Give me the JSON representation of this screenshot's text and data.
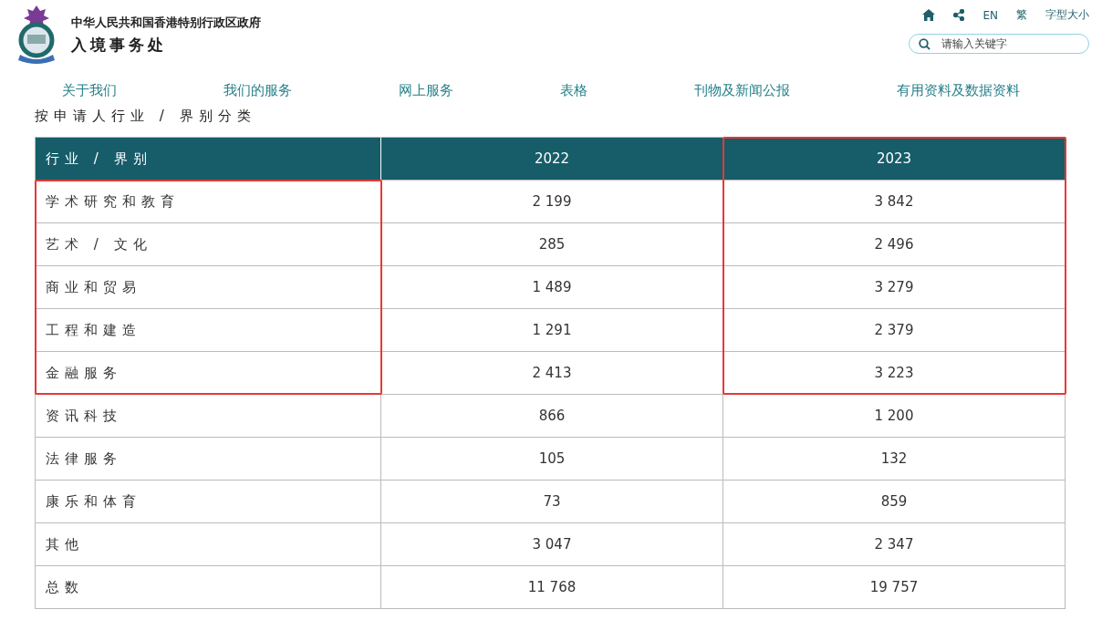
{
  "header": {
    "government": "中华人民共和国香港特别行政区政府",
    "department": "入境事务处"
  },
  "utility_links": [
    "EN",
    "繁",
    "字型大小"
  ],
  "search": {
    "placeholder": "请输入关键字"
  },
  "nav": [
    "关于我们",
    "我们的服务",
    "网上服务",
    "表格",
    "刊物及新闻公报",
    "有用资料及数据资料"
  ],
  "page_title": "按申请人行业 / 界别分类",
  "table": {
    "columns": [
      {
        "label": "行业 / 界别",
        "highlighted": false
      },
      {
        "label": "2022",
        "highlighted": false
      },
      {
        "label": "2023",
        "highlighted": true
      }
    ],
    "rows": [
      {
        "cells": [
          {
            "text": "学术研究和教育",
            "highlighted": true
          },
          {
            "text": "2 199",
            "highlighted": false
          },
          {
            "text": "3 842",
            "highlighted": true
          }
        ]
      },
      {
        "cells": [
          {
            "text": "艺术 / 文化",
            "highlighted": true
          },
          {
            "text": "285",
            "highlighted": false
          },
          {
            "text": "2 496",
            "highlighted": true
          }
        ]
      },
      {
        "cells": [
          {
            "text": "商业和贸易",
            "highlighted": true
          },
          {
            "text": "1 489",
            "highlighted": false
          },
          {
            "text": "3 279",
            "highlighted": true
          }
        ]
      },
      {
        "cells": [
          {
            "text": "工程和建造",
            "highlighted": true
          },
          {
            "text": "1 291",
            "highlighted": false
          },
          {
            "text": "2 379",
            "highlighted": true
          }
        ]
      },
      {
        "cells": [
          {
            "text": "金融服务",
            "highlighted": true
          },
          {
            "text": "2 413",
            "highlighted": false
          },
          {
            "text": "3 223",
            "highlighted": true
          }
        ]
      },
      {
        "cells": [
          {
            "text": "资讯科技",
            "highlighted": false
          },
          {
            "text": "866",
            "highlighted": false
          },
          {
            "text": "1 200",
            "highlighted": false
          }
        ]
      },
      {
        "cells": [
          {
            "text": "法律服务",
            "highlighted": false
          },
          {
            "text": "105",
            "highlighted": false
          },
          {
            "text": "132",
            "highlighted": false
          }
        ]
      },
      {
        "cells": [
          {
            "text": "康乐和体育",
            "highlighted": false
          },
          {
            "text": "73",
            "highlighted": false
          },
          {
            "text": "859",
            "highlighted": false
          }
        ]
      },
      {
        "cells": [
          {
            "text": "其他",
            "highlighted": false
          },
          {
            "text": "3 047",
            "highlighted": false
          },
          {
            "text": "2 347",
            "highlighted": false
          }
        ]
      },
      {
        "cells": [
          {
            "text": "总数",
            "highlighted": false
          },
          {
            "text": "11 768",
            "highlighted": false
          },
          {
            "text": "19 757",
            "highlighted": false
          }
        ]
      }
    ]
  }
}
